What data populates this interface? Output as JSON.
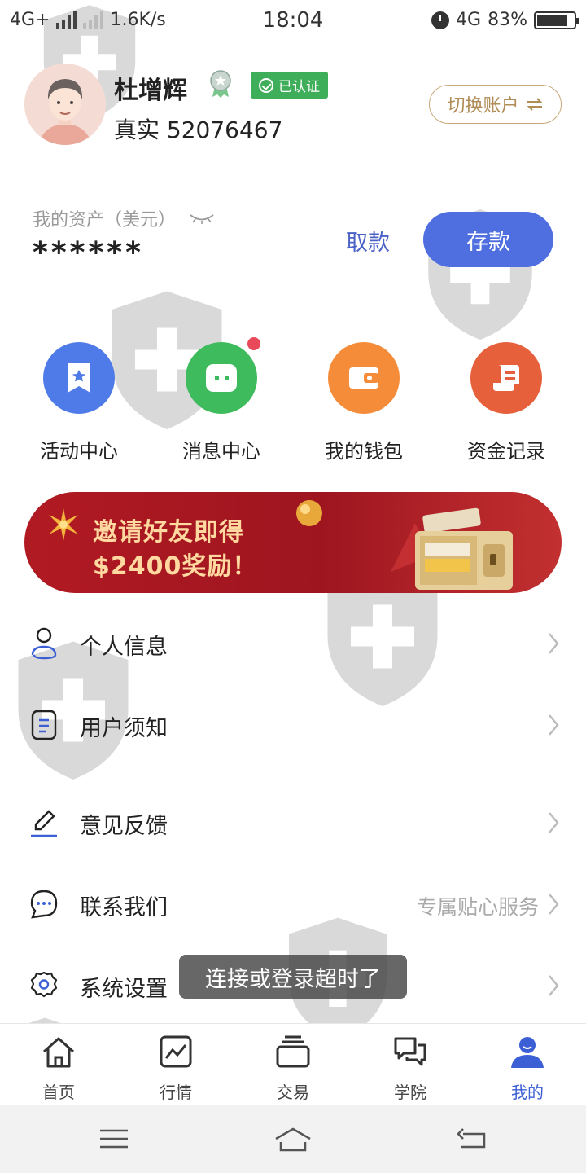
{
  "status_bar": {
    "network_left": "4G+",
    "speed": "1.6K/s",
    "time": "18:04",
    "network_right": "4G",
    "battery": "83%",
    "battery_level": 0.83
  },
  "profile": {
    "name": "杜增辉",
    "verified_label": "已认证",
    "account_type": "真实",
    "account_id": "52076467",
    "switch_account_label": "切换账户"
  },
  "assets": {
    "label": "我的资产（美元）",
    "value": "******",
    "withdraw_label": "取款",
    "deposit_label": "存款"
  },
  "quick_actions": [
    {
      "label": "活动中心",
      "icon": "bookmark-star-icon",
      "color": "#4f7be8"
    },
    {
      "label": "消息中心",
      "icon": "chat-bubble-icon",
      "color": "#3dbb5d"
    },
    {
      "label": "我的钱包",
      "icon": "wallet-icon",
      "color": "#f58c3a"
    },
    {
      "label": "资金记录",
      "icon": "scroll-record-icon",
      "color": "#e5603b"
    }
  ],
  "banner": {
    "line1": "邀请好友即得",
    "line2": "$2400奖励！"
  },
  "menu": [
    {
      "label": "个人信息",
      "icon": "person-icon",
      "hint": ""
    },
    {
      "label": "用户须知",
      "icon": "document-icon",
      "hint": ""
    },
    {
      "label": "意见反馈",
      "icon": "pencil-icon",
      "hint": ""
    },
    {
      "label": "联系我们",
      "icon": "chat-dots-icon",
      "hint": "专属贴心服务"
    },
    {
      "label": "系统设置",
      "icon": "gear-icon",
      "hint": ""
    }
  ],
  "toast": "连接或登录超时了",
  "tabs": [
    {
      "label": "首页",
      "icon": "home-icon"
    },
    {
      "label": "行情",
      "icon": "chart-icon"
    },
    {
      "label": "交易",
      "icon": "layers-icon"
    },
    {
      "label": "学院",
      "icon": "discussion-icon"
    },
    {
      "label": "我的",
      "icon": "user-icon",
      "active": true
    }
  ],
  "colors": {
    "accent": "#3c5fd6",
    "deposit": "#4f6fe0",
    "verified": "#3fae5a",
    "switch_border": "#c8a97a"
  }
}
